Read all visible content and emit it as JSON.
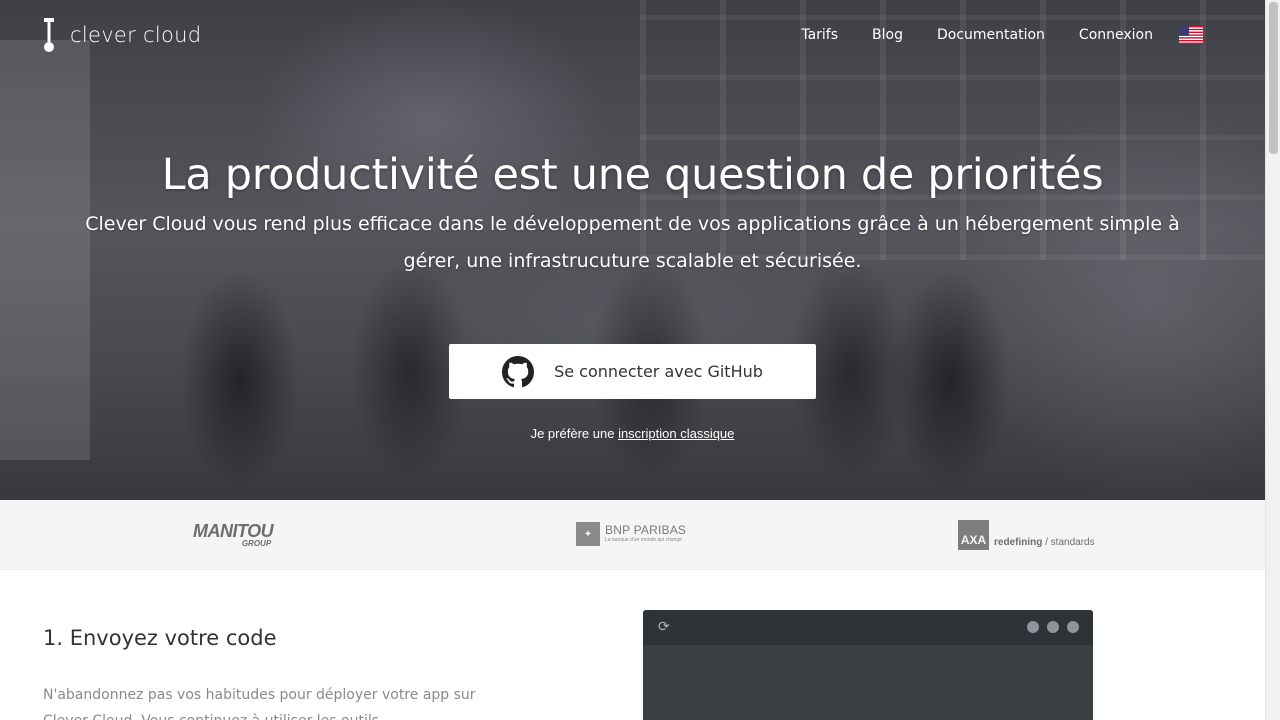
{
  "header": {
    "logo_text": "clever cloud",
    "nav": [
      {
        "label": "Tarifs"
      },
      {
        "label": "Blog"
      },
      {
        "label": "Documentation"
      },
      {
        "label": "Connexion"
      }
    ],
    "language_flag": "us-flag-icon"
  },
  "hero": {
    "title": "La productivité est une question de priorités",
    "subtitle": "Clever Cloud vous rend plus efficace dans le développement de vos applications grâce à un hébergement simple à gérer, une infrastrucuture scalable et sécurisée.",
    "github_button_label": "Se connecter avec GitHub",
    "alt_prefix": "Je préfère une",
    "alt_link": "inscription classique"
  },
  "clients": {
    "manitou": {
      "name": "MANITOU",
      "sub": "GROUP"
    },
    "bnp": {
      "name": "BNP PARIBAS",
      "tagline": "La banque d'un monde qui change"
    },
    "axa": {
      "mark": "AXA",
      "tagline_bold": "redefining",
      "tagline_rest": "/ standards"
    }
  },
  "features": {
    "step1_title": "1. Envoyez votre code",
    "step1_text": "N'abandonnez pas vos habitudes pour déployer votre app sur Clever Cloud. Vous continuez à utiliser les outils..."
  },
  "terminal": {
    "refresh_icon": "refresh-icon"
  },
  "colors": {
    "hero_overlay": "#4a4a50",
    "button_bg": "#ffffff",
    "clients_bg": "#f5f5f5",
    "terminal_bg": "#3a3f44",
    "terminal_bar": "#2e3338"
  }
}
